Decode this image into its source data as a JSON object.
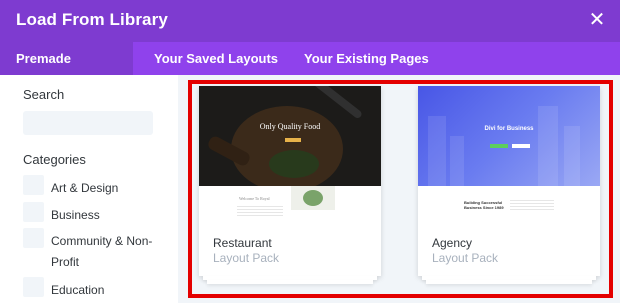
{
  "modal": {
    "title": "Load From Library",
    "close_icon": "close-icon",
    "close_glyph": "✕"
  },
  "tabs": [
    {
      "label": "Premade Layouts",
      "active": true
    },
    {
      "label": "Your Saved Layouts",
      "active": false
    },
    {
      "label": "Your Existing Pages",
      "active": false
    }
  ],
  "sidebar": {
    "search_heading": "Search",
    "search_value": "",
    "categories_heading": "Categories",
    "categories": [
      {
        "label": "Art & Design",
        "checked": false
      },
      {
        "label": "Business",
        "checked": false
      },
      {
        "label": "Community & Non-",
        "label_cont": "Profit",
        "checked": false
      },
      {
        "label": "Education",
        "checked": false
      }
    ]
  },
  "layouts": [
    {
      "title": "Restaurant",
      "subtitle": "Layout Pack",
      "preview_heading": "Only Quality Food",
      "preview_subheading": "Welcome To Royal"
    },
    {
      "title": "Agency",
      "subtitle": "Layout Pack",
      "preview_heading": "Divi for Business",
      "preview_subheading": "Building Successful Business Since 1989"
    }
  ],
  "colors": {
    "header_bg": "#7e3bd0",
    "tabs_bg": "#8f42ec",
    "highlight_border": "#e40000",
    "content_bg": "#f1f5f9"
  }
}
